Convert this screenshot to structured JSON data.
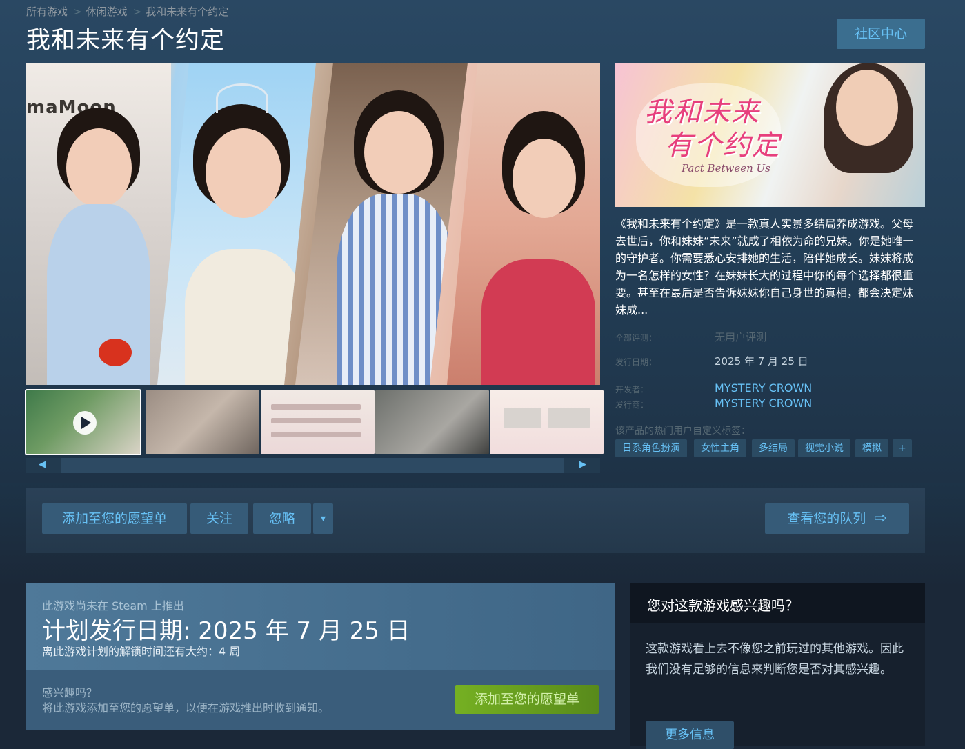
{
  "breadcrumb": [
    "所有游戏",
    "休闲游戏",
    "我和未来有个约定"
  ],
  "breadcrumb_separator": ">",
  "game_title": "我和未来有个约定",
  "community_button": "社区中心",
  "media_watermark": "maMoon",
  "capsule": {
    "title_line1": "我和未来",
    "title_line2": "有个约定",
    "subtitle": "Pact Between Us"
  },
  "description": "《我和未来有个约定》是一款真人实景多结局养成游戏。父母去世后，你和妹妹“未来”就成了相依为命的兄妹。你是她唯一的守护者。你需要悉心安排她的生活，陪伴她成长。妹妹将成为一名怎样的女性？在妹妹长大的过程中你的每个选择都很重要。甚至在最后是否告诉妹妹你自己身世的真相，都会决定妹妹成...",
  "meta": {
    "reviews_label": "全部评测：",
    "reviews_value": "无用户评测",
    "release_label": "发行日期：",
    "release_value": "2025 年 7 月 25 日",
    "developer_label": "开发者：",
    "developer_value": "MYSTERY CROWN",
    "publisher_label": "发行商：",
    "publisher_value": "MYSTERY CROWN",
    "tags_label": "该产品的热门用户自定义标签："
  },
  "tags": [
    "日系角色扮演",
    "女性主角",
    "多结局",
    "视觉小说",
    "模拟",
    "+"
  ],
  "actions": {
    "wishlist": "添加至您的愿望单",
    "follow": "关注",
    "ignore": "忽略",
    "dropdown": "▾",
    "queue": "查看您的队列",
    "queue_arrow": "⇨"
  },
  "release_box": {
    "not_released": "此游戏尚未在 Steam 上推出",
    "planned_date": "计划发行日期: 2025 年 7 月 25 日",
    "eta": "离此游戏计划的解锁时间还有大约：4 周",
    "interested": "感兴趣吗？",
    "notify": "将此游戏添加至您的愿望单，以便在游戏推出时收到通知。",
    "wishlist_button": "添加至您的愿望单"
  },
  "interest_box": {
    "title": "您对这款游戏感兴趣吗？",
    "text": "这款游戏看上去不像您之前玩过的其他游戏。因此我们没有足够的信息来判断您是否对其感兴趣。",
    "more_button": "更多信息"
  },
  "scroll": {
    "left": "◀",
    "right": "▶"
  },
  "colors": {
    "background": "#1b2838",
    "link": "#67c1f5",
    "green_button": "#75b022",
    "tag_bg": "#2b4b63"
  }
}
